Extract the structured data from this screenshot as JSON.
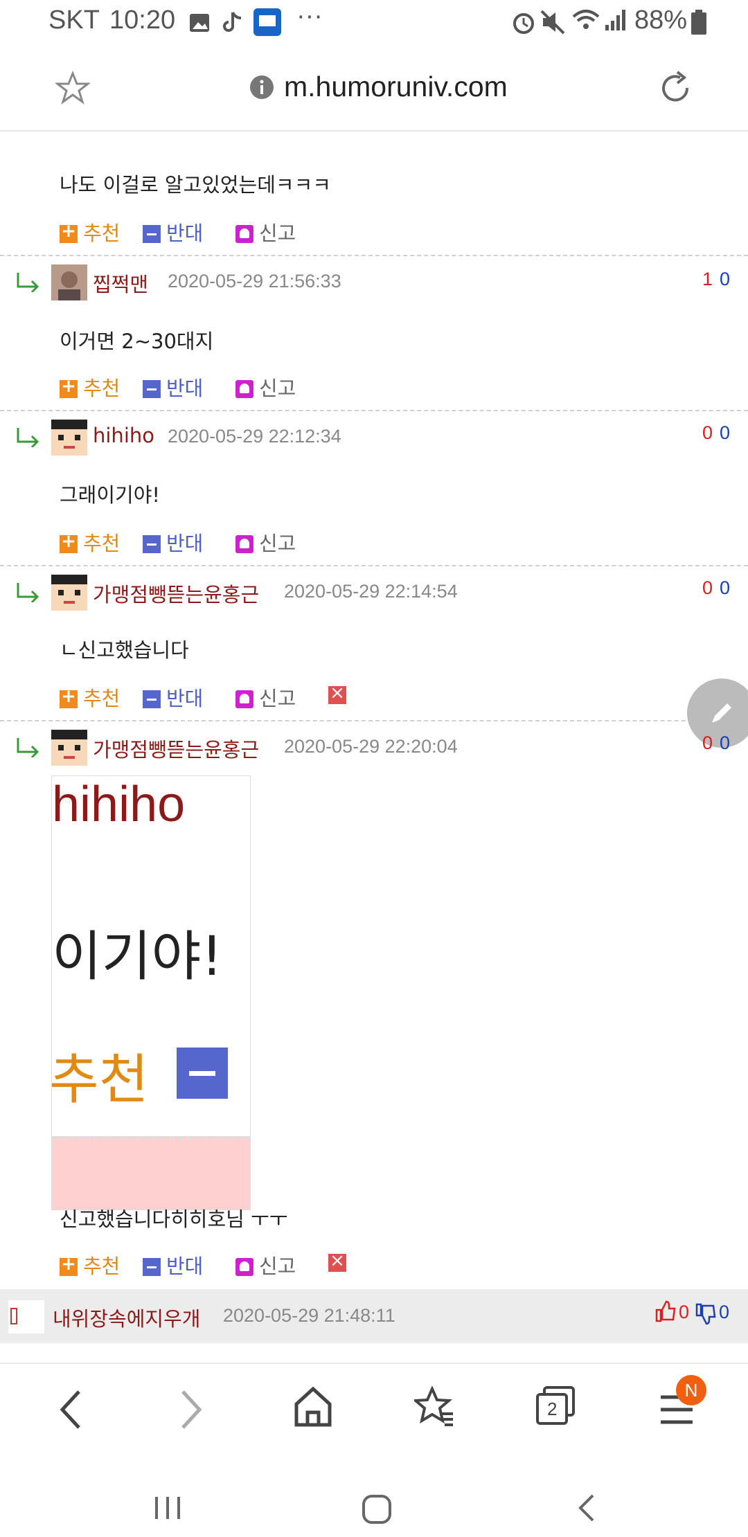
{
  "status_bar": {
    "carrier": "SKT",
    "time": "10:20",
    "more": "···",
    "battery": "88%"
  },
  "url_bar": {
    "url": "m.humoruniv.com",
    "info_icon": "info-icon",
    "star_icon": "star-outline-icon",
    "refresh_icon": "refresh-icon"
  },
  "comments": [
    {
      "nick": "",
      "date": "",
      "text": "나도 이걸로 알고있었는데ㅋㅋㅋ",
      "actions": {
        "up": "추천",
        "down": "반대",
        "report": "신고"
      }
    },
    {
      "nick": "찝쩍맨",
      "date": "2020-05-29 21:56:33",
      "votes_up": "1",
      "votes_down": "0",
      "text": "이거면 2~30대지",
      "actions": {
        "up": "추천",
        "down": "반대",
        "report": "신고"
      }
    },
    {
      "nick": "hihiho",
      "date": "2020-05-29 22:12:34",
      "votes_up": "0",
      "votes_down": "0",
      "text": "그래이기야!",
      "actions": {
        "up": "추천",
        "down": "반대",
        "report": "신고"
      }
    },
    {
      "nick": "가맹점뺑뜯는윤홍근",
      "date": "2020-05-29 22:14:54",
      "votes_up": "0",
      "votes_down": "0",
      "text": "ㄴ신고했습니다",
      "actions": {
        "up": "추천",
        "down": "반대",
        "report": "신고"
      }
    },
    {
      "nick": "가맹점뺑뜯는윤홍근",
      "date": "2020-05-29 22:20:04",
      "votes_up": "0",
      "votes_down": "0",
      "image_text": {
        "line1": "hihiho",
        "line2": "이기야!",
        "line3": "추천"
      },
      "text": "신고했습니다히히호님 ㅜㅜ",
      "actions": {
        "up": "추천",
        "down": "반대",
        "report": "신고"
      }
    }
  ],
  "top_comment": {
    "nick": "내위장속에지우개",
    "date": "2020-05-29 21:48:11",
    "likes": "0",
    "dislikes": "0"
  },
  "bottom_nav": {
    "tabs_count": "2",
    "badge": "N"
  },
  "colors": {
    "nick": "#8b1a1a",
    "up_label": "#e08a14",
    "down_label": "#4d5fbf",
    "vote_up": "#d8201f",
    "vote_down": "#1a3fb0"
  }
}
